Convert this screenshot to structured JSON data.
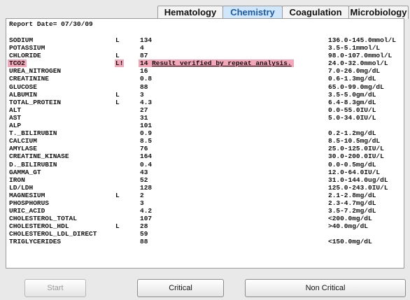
{
  "tabs": [
    "Hematology",
    "Chemistry",
    "Coagulation",
    "Microbiology"
  ],
  "active_tab": "Chemistry",
  "report_date": "Report Date= 07/30/09",
  "tests": [
    {
      "name": "SODIUM",
      "flag": "L",
      "value": "134",
      "range": "136.0-145.0mmol/L"
    },
    {
      "name": "POTASSIUM",
      "flag": "",
      "value": "4",
      "range": "3.5-5.1mmol/L"
    },
    {
      "name": "CHLORIDE",
      "flag": "L",
      "value": "87",
      "range": "98.0-107.0mmol/L"
    },
    {
      "name": "TCO2",
      "flag": "L!",
      "value": "14",
      "comment": "Result verified by repeat analysis.",
      "range": "24.0-32.0mmol/L"
    },
    {
      "name": "UREA_NITROGEN",
      "flag": "",
      "value": "16",
      "range": "7.0-26.0mg/dL"
    },
    {
      "name": "CREATININE",
      "flag": "",
      "value": "0.8",
      "range": "0.6-1.3mg/dL"
    },
    {
      "name": "GLUCOSE",
      "flag": "",
      "value": "88",
      "range": "65.0-99.0mg/dL"
    },
    {
      "name": "ALBUMIN",
      "flag": "L",
      "value": "3",
      "range": "3.5-5.0gm/dL"
    },
    {
      "name": "TOTAL_PROTEIN",
      "flag": "L",
      "value": "4.3",
      "range": "6.4-8.3gm/dL"
    },
    {
      "name": "ALT",
      "flag": "",
      "value": "27",
      "range": "0.0-55.0IU/L"
    },
    {
      "name": "AST",
      "flag": "",
      "value": "31",
      "range": "5.0-34.0IU/L"
    },
    {
      "name": "ALP",
      "flag": "",
      "value": "101",
      "range": ""
    },
    {
      "name": "T._BILIRUBIN",
      "flag": "",
      "value": "0.9",
      "range": "0.2-1.2mg/dL"
    },
    {
      "name": "CALCIUM",
      "flag": "",
      "value": "8.5",
      "range": "8.5-10.5mg/dL"
    },
    {
      "name": "AMYLASE",
      "flag": "",
      "value": "76",
      "range": "25.0-125.0IU/L"
    },
    {
      "name": "CREATINE_KINASE",
      "flag": "",
      "value": "164",
      "range": "30.0-200.0IU/L"
    },
    {
      "name": "D._BILIRUBIN",
      "flag": "",
      "value": "0.4",
      "range": "0.0-0.5mg/dL"
    },
    {
      "name": "GAMMA_GT",
      "flag": "",
      "value": "43",
      "range": "12.0-64.0IU/L"
    },
    {
      "name": "IRON",
      "flag": "",
      "value": "52",
      "range": "31.0-144.0ug/dL"
    },
    {
      "name": "LD/LDH",
      "flag": "",
      "value": "128",
      "range": "125.0-243.0IU/L"
    },
    {
      "name": "MAGNESIUM",
      "flag": "L",
      "value": "2",
      "range": "2.1-2.8mg/dL"
    },
    {
      "name": "PHOSPHORUS",
      "flag": "",
      "value": "3",
      "range": "2.3-4.7mg/dL"
    },
    {
      "name": "URIC_ACID",
      "flag": "",
      "value": "4.2",
      "range": "3.5-7.2mg/dL"
    },
    {
      "name": "CHOLESTEROL_TOTAL",
      "flag": "",
      "value": "107",
      "range": "<200.0mg/dL"
    },
    {
      "name": "CHOLESTEROL_HDL",
      "flag": "L",
      "value": "28",
      "range": ">40.0mg/dL"
    },
    {
      "name": "CHOLESTEROL_LDL_DIRECT",
      "flag": "",
      "value": "59",
      "range": ""
    },
    {
      "name": "TRIGLYCERIDES",
      "flag": "",
      "value": "88",
      "range": "<150.0mg/dL"
    }
  ],
  "buttons": {
    "start": "Start",
    "critical": "Critical",
    "non_critical": "Non Critical"
  },
  "colors": {
    "highlight": "#f3a7b9",
    "active_tab_bg": "#cfe6fb",
    "active_tab_text": "#1c5aa6"
  }
}
